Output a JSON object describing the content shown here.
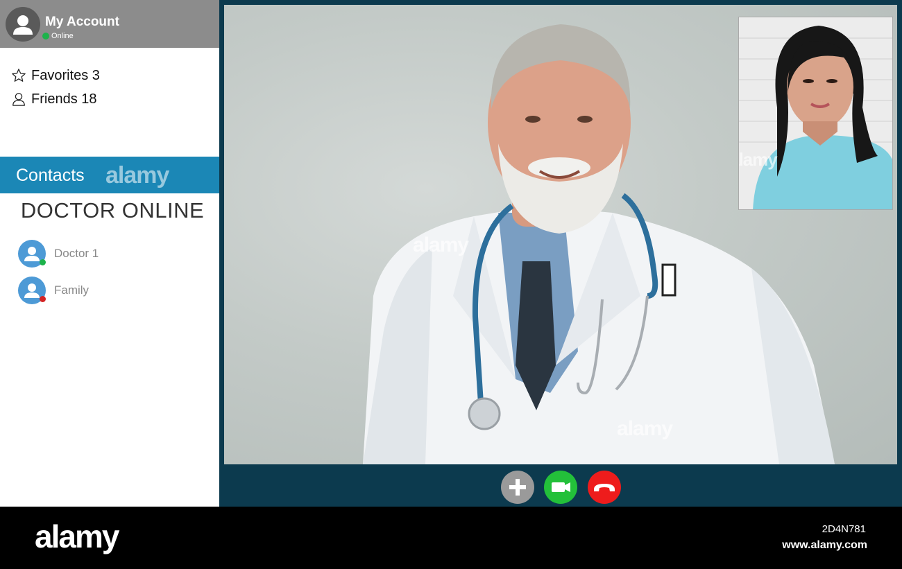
{
  "account": {
    "name": "My Account",
    "status": "Online",
    "status_color": "#1db34b"
  },
  "stats": {
    "favorites_label": "Favorites 3",
    "friends_label": "Friends 18"
  },
  "contacts": {
    "header": "Contacts",
    "header_watermark": "alamy",
    "section_title": "DOCTOR ONLINE",
    "items": [
      {
        "name": "Doctor 1",
        "status_color": "#1db34b",
        "icon": "user-avatar-icon"
      },
      {
        "name": "Family",
        "status_color": "#d42424",
        "icon": "user-avatar-icon"
      }
    ]
  },
  "video": {
    "watermark": "alamy"
  },
  "controls": {
    "add": {
      "icon": "plus-icon",
      "color": "#9a9a9a"
    },
    "video": {
      "icon": "video-camera-icon",
      "color": "#23c03a"
    },
    "end": {
      "icon": "phone-hangup-icon",
      "color": "#ee1c1c"
    }
  },
  "footer": {
    "logo": "alamy",
    "image_id": "2D4N781",
    "url": "www.alamy.com"
  },
  "colors": {
    "accent": "#1b87b6",
    "frame": "#0c3a4e",
    "header_gray": "#8c8c8c"
  }
}
